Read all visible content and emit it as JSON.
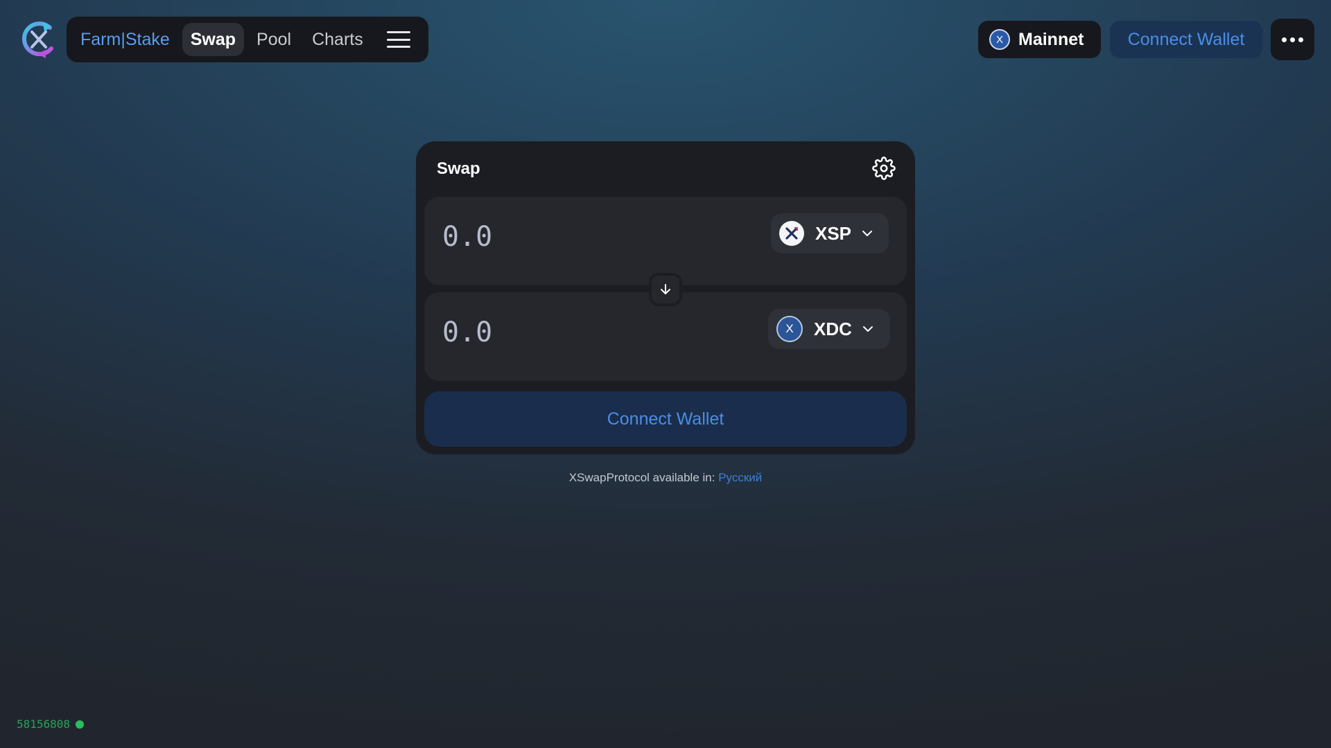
{
  "header": {
    "nav": {
      "farm_stake": "Farm|Stake",
      "swap": "Swap",
      "pool": "Pool",
      "charts": "Charts"
    },
    "network": {
      "icon_letter": "X",
      "label": "Mainnet"
    },
    "connect_wallet": "Connect Wallet"
  },
  "swap_card": {
    "title": "Swap",
    "input_token": {
      "amount_placeholder": "0.0",
      "symbol": "XSP"
    },
    "output_token": {
      "amount_placeholder": "0.0",
      "symbol": "XDC",
      "icon_letter": "X"
    },
    "connect_wallet": "Connect Wallet"
  },
  "footer": {
    "available_text": "XSwapProtocol available in:",
    "language_link": "Русский",
    "block_number": "58156808"
  },
  "colors": {
    "accent_blue": "#4a8ee6",
    "status_green": "#2bbd5e"
  }
}
